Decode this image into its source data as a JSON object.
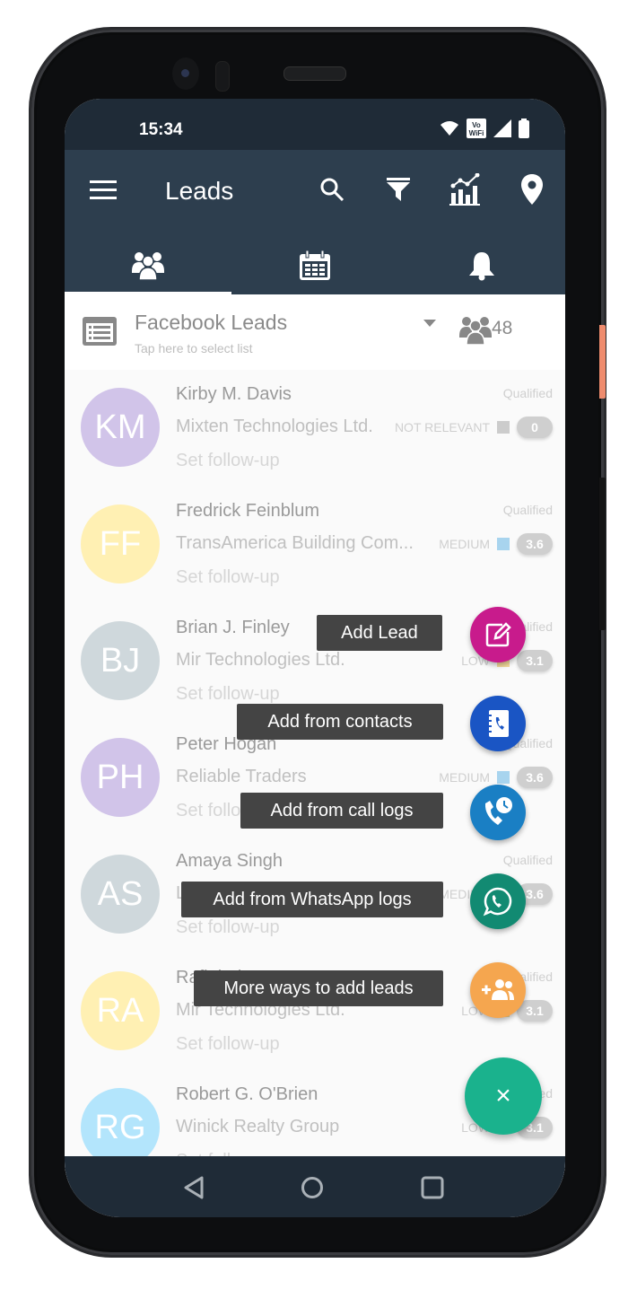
{
  "status_bar": {
    "time": "15:34",
    "icons": [
      "wifi-icon",
      "vowifi-icon",
      "signal-icon",
      "battery-icon"
    ]
  },
  "app_bar": {
    "title": "Leads",
    "actions": [
      "search-icon",
      "filter-icon",
      "analytics-icon",
      "location-icon"
    ]
  },
  "tabs": [
    {
      "icon": "people-icon",
      "selected": true
    },
    {
      "icon": "calendar-icon",
      "selected": false
    },
    {
      "icon": "bell-icon",
      "selected": false
    }
  ],
  "list_selector": {
    "name": "Facebook Leads",
    "hint": "Tap here to select list",
    "count": "48"
  },
  "leads": [
    {
      "initials": "KM",
      "name": "Kirby M. Davis",
      "company": "Mixten Technologies Ltd.",
      "followup": "Set follow-up",
      "status": "Qualified",
      "priority": "NOT RELEVANT",
      "priority_color": "#cccccc",
      "score": "0",
      "avatar_color": "#d1c4e9"
    },
    {
      "initials": "FF",
      "name": "Fredrick Feinblum",
      "company": "TransAmerica Building Com...",
      "followup": "Set follow-up",
      "status": "Qualified",
      "priority": "MEDIUM",
      "priority_color": "#a8d4ee",
      "score": "3.6",
      "avatar_color": "#fff0b3"
    },
    {
      "initials": "BJ",
      "name": "Brian J. Finley",
      "company": "Mir Technologies Ltd.",
      "followup": "Set follow-up",
      "status": "Qualified",
      "priority": "LOW",
      "priority_color": "#f3d99b",
      "score": "3.1",
      "avatar_color": "#cfd8dc"
    },
    {
      "initials": "PH",
      "name": "Peter Hogan",
      "company": "Reliable Traders",
      "followup": "Set follow-up",
      "status": "Qualified",
      "priority": "MEDIUM",
      "priority_color": "#a8d4ee",
      "score": "3.6",
      "avatar_color": "#d1c4e9"
    },
    {
      "initials": "AS",
      "name": "Amaya Singh",
      "company": "Lex Orbis",
      "followup": "Set follow-up",
      "status": "Qualified",
      "priority": "MEDIUM",
      "priority_color": "#a8d4ee",
      "score": "3.6",
      "avatar_color": "#cfd8dc"
    },
    {
      "initials": "RA",
      "name": "Rafiul Alam",
      "company": "Mir Technologies Ltd.",
      "followup": "Set follow-up",
      "status": "Qualified",
      "priority": "LOW",
      "priority_color": "#f3d99b",
      "score": "3.1",
      "avatar_color": "#fff0b3"
    },
    {
      "initials": "RG",
      "name": "Robert G. O'Brien",
      "company": "Winick Realty Group",
      "followup": "Set follow-up",
      "status": "Qualified",
      "priority": "LOW",
      "priority_color": "#f3d99b",
      "score": "3.1",
      "avatar_color": "#b3e5fc"
    }
  ],
  "fab_menu": [
    {
      "label": "Add Lead",
      "icon": "edit-note-icon",
      "color": "#c81b8c"
    },
    {
      "label": "Add from contacts",
      "icon": "contacts-book-icon",
      "color": "#1a55c4"
    },
    {
      "label": "Add from call logs",
      "icon": "call-log-icon",
      "color": "#1a7fc4"
    },
    {
      "label": "Add from WhatsApp logs",
      "icon": "whatsapp-icon",
      "color": "#128a72"
    },
    {
      "label": "More ways to add leads",
      "icon": "add-group-icon",
      "color": "#f5a64f"
    }
  ],
  "fab_main": {
    "label": "×",
    "color": "#1ab28d"
  },
  "nav_bar": [
    "back-icon",
    "home-icon",
    "recents-icon"
  ]
}
